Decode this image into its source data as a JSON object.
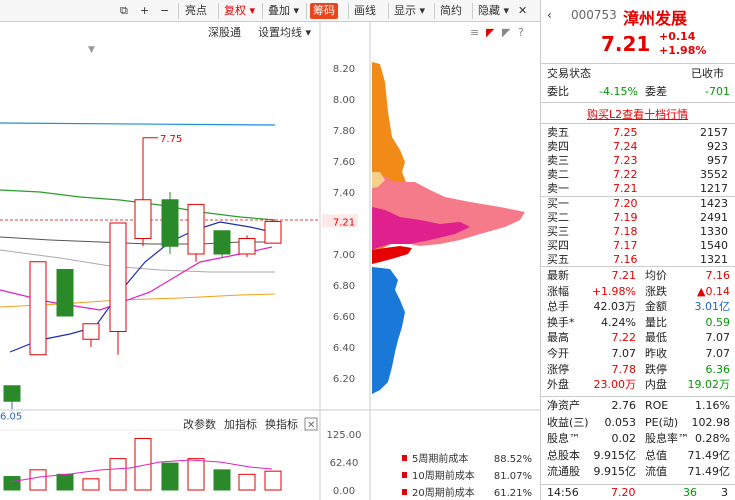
{
  "toolbar": {
    "items": [
      "亮点",
      "复权",
      "叠加",
      "筹码",
      "画线",
      "显示",
      "简约",
      "隐藏"
    ],
    "active": "筹码"
  },
  "chart_header": {
    "shen_gu_tong": "深股通",
    "set_ma": "设置均线"
  },
  "price_axis": {
    "labels": [
      "8.20",
      "8.00",
      "7.80",
      "7.60",
      "7.40",
      "7.21",
      "7.00",
      "6.80",
      "6.60",
      "6.40",
      "6.20"
    ]
  },
  "annotations": {
    "high": "7.75",
    "low": "6.05"
  },
  "indicator_bar": {
    "change_params": "改参数",
    "add_indicator": "加指标",
    "switch_indicator": "换指标"
  },
  "volume_axis": {
    "labels": [
      "125.00",
      "62.40",
      "0.00"
    ]
  },
  "cost_legend": [
    {
      "label": "5周期前成本",
      "value": "88.52%",
      "color": "#e60000"
    },
    {
      "label": "10周期前成本",
      "value": "81.07%",
      "color": "#e60000"
    },
    {
      "label": "20周期前成本",
      "value": "61.21%",
      "color": "#e60000"
    }
  ],
  "stock": {
    "code": "000753",
    "name": "漳州发展",
    "price": "7.21",
    "change": "+0.14",
    "change_pct": "+1.98%",
    "trade_status_label": "交易状态",
    "trade_status": "已收市",
    "wei_bi_label": "委比",
    "wei_bi": "-4.15%",
    "wei_cha_label": "委差",
    "wei_cha": "-701",
    "buy_l2": "购买L2查看十档行情"
  },
  "order_book": {
    "sell": [
      {
        "label": "卖五",
        "price": "7.25",
        "vol": "2157"
      },
      {
        "label": "卖四",
        "price": "7.24",
        "vol": "923"
      },
      {
        "label": "卖三",
        "price": "7.23",
        "vol": "957"
      },
      {
        "label": "卖二",
        "price": "7.22",
        "vol": "3552"
      },
      {
        "label": "卖一",
        "price": "7.21",
        "vol": "1217"
      }
    ],
    "buy": [
      {
        "label": "买一",
        "price": "7.20",
        "vol": "1423"
      },
      {
        "label": "买二",
        "price": "7.19",
        "vol": "2491"
      },
      {
        "label": "买三",
        "price": "7.18",
        "vol": "1330"
      },
      {
        "label": "买四",
        "price": "7.17",
        "vol": "1540"
      },
      {
        "label": "买五",
        "price": "7.16",
        "vol": "1321"
      }
    ]
  },
  "stats": [
    {
      "l1": "最新",
      "v1": "7.21",
      "c1": "red",
      "l2": "均价",
      "v2": "7.16",
      "c2": "red"
    },
    {
      "l1": "涨幅",
      "v1": "+1.98%",
      "c1": "red",
      "l2": "涨跌",
      "v2": "▲0.14",
      "c2": "red"
    },
    {
      "l1": "总手",
      "v1": "42.03万",
      "c1": "txt-dark",
      "l2": "金额",
      "v2": "3.01亿",
      "c2": "blue"
    },
    {
      "l1": "换手*",
      "v1": "4.24%",
      "c1": "txt-dark",
      "l2": "量比",
      "v2": "0.59",
      "c2": "green"
    },
    {
      "l1": "最高",
      "v1": "7.22",
      "c1": "red",
      "l2": "最低",
      "v2": "7.07",
      "c2": "txt-dark"
    },
    {
      "l1": "今开",
      "v1": "7.07",
      "c1": "txt-dark",
      "l2": "昨收",
      "v2": "7.07",
      "c2": "txt-dark"
    },
    {
      "l1": "涨停",
      "v1": "7.78",
      "c1": "red",
      "l2": "跌停",
      "v2": "6.36",
      "c2": "green"
    },
    {
      "l1": "外盘",
      "v1": "23.00万",
      "c1": "red",
      "l2": "内盘",
      "v2": "19.02万",
      "c2": "green"
    }
  ],
  "fundamentals": [
    {
      "l1": "净资产",
      "v1": "2.76",
      "l2": "ROE",
      "v2": "1.16%"
    },
    {
      "l1": "收益(三)",
      "v1": "0.053",
      "l2": "PE(动)",
      "v2": "102.98"
    },
    {
      "l1": "股息™",
      "v1": "0.02",
      "l2": "股息率™",
      "v2": "0.28%"
    },
    {
      "l1": "总股本",
      "v1": "9.915亿",
      "l2": "总值",
      "v2": "71.49亿"
    },
    {
      "l1": "流通股",
      "v1": "9.915亿",
      "l2": "流值",
      "v2": "71.49亿"
    }
  ],
  "last_trade": {
    "time": "14:56",
    "price": "7.20",
    "vol": "36",
    "count": "3"
  },
  "chart_data": {
    "type": "candlestick",
    "candles": [
      {
        "o": 6.15,
        "c": 6.05,
        "h": 6.15,
        "l": 6.05
      },
      {
        "o": 6.35,
        "c": 6.95,
        "h": 6.95,
        "l": 6.35
      },
      {
        "o": 6.9,
        "c": 6.6,
        "h": 6.9,
        "l": 6.6
      },
      {
        "o": 6.45,
        "c": 6.55,
        "h": 6.55,
        "l": 6.4
      },
      {
        "o": 6.5,
        "c": 7.2,
        "h": 7.2,
        "l": 6.35
      },
      {
        "o": 7.1,
        "c": 7.35,
        "h": 7.75,
        "l": 7.05
      },
      {
        "o": 7.35,
        "c": 7.05,
        "h": 7.4,
        "l": 7.0
      },
      {
        "o": 7.0,
        "c": 7.32,
        "h": 7.32,
        "l": 6.95
      },
      {
        "o": 7.15,
        "c": 7.0,
        "h": 7.15,
        "l": 6.98
      },
      {
        "o": 7.0,
        "c": 7.1,
        "h": 7.12,
        "l": 6.98
      },
      {
        "o": 7.07,
        "c": 7.21,
        "h": 7.22,
        "l": 7.07
      }
    ],
    "volumes": [
      30,
      45,
      35,
      25,
      70,
      115,
      60,
      70,
      45,
      35,
      42
    ]
  }
}
